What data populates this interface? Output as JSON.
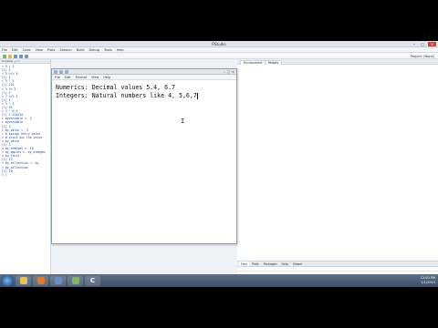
{
  "app": {
    "title": "RStudio",
    "window_controls": [
      "–",
      "□",
      "✕"
    ]
  },
  "menubar": [
    "File",
    "Edit",
    "Code",
    "View",
    "Plots",
    "Session",
    "Build",
    "Debug",
    "Tools",
    "Help"
  ],
  "toolbar": {
    "project_label": "Project: (None)"
  },
  "console": {
    "header": "Console ~/ ⇨",
    "lines": [
      "> 5 / 3",
      "[1] 2",
      "> 5 %/% 3",
      "[1] 1",
      "> 5 ^ 3",
      "[1] 125",
      "> 5 %% 3",
      "[1] 2",
      "> 7 %/% 3",
      "[1] 2",
      "> 5 ^ 2",
      "[1] 25",
      "> 2 ^ 0.5",
      "[1] 1.414214",
      "> myvariable <- 3",
      "> myvariable",
      "[1] 3",
      "> my_value <- 3",
      "> # assign entry value",
      "> # print out the value",
      "> my_value",
      "[1] 3",
      "> my_oranges <- 10",
      "> my_apples <- my_oranges",
      "> my_fruit",
      "[1] 13",
      "> my_collection <- my_",
      "> my_collection",
      "[1] 10",
      "> |"
    ]
  },
  "env_tabs": [
    "Environment",
    "History"
  ],
  "files_tabs": [
    "Files",
    "Plots",
    "Packages",
    "Help",
    "Viewer"
  ],
  "rwin": {
    "menu": [
      "File",
      "Edit",
      "Format",
      "View",
      "Help"
    ],
    "lines": [
      "Numerics: Decimal values 5.4, 6.7",
      "Integers: Natural numbers like 4, 5,6,7"
    ]
  },
  "taskbar": {
    "items": [
      "",
      "",
      "",
      "",
      "C"
    ],
    "clock": [
      "12:00 PM",
      "1/1/2015"
    ]
  },
  "colors": {
    "accent": "#2c5f9a",
    "console_text": "#1a3f8f",
    "taskbar_top": "#5b6f86",
    "taskbar_bottom": "#3f5068"
  }
}
